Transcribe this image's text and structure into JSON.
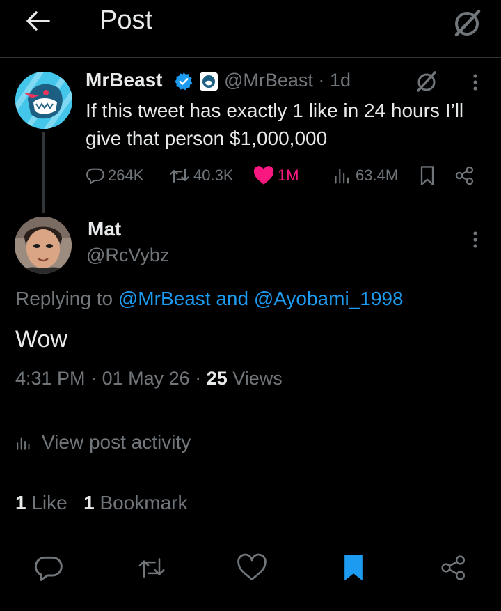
{
  "header": {
    "title": "Post"
  },
  "parent_tweet": {
    "author_name": "MrBeast",
    "handle_time": "@MrBeast · 1d",
    "text": "If this tweet has exactly 1 like in 24 hours I’ll give that person $1,000,000",
    "stats": {
      "replies": "264K",
      "reposts": "40.3K",
      "likes": "1M",
      "views": "63.4M"
    }
  },
  "reply": {
    "author_name": "Mat",
    "handle": "@RcVybz",
    "replying_prefix": "Replying to",
    "replying_users": "@MrBeast and @Ayobami_1998",
    "body": "Wow",
    "time": "4:31 PM",
    "date": "01 May 26",
    "views_count": "25",
    "views_label": "Views",
    "activity_label": "View post activity",
    "likes_count": "1",
    "likes_label": "Like",
    "bookmarks_count": "1",
    "bookmarks_label": "Bookmark"
  },
  "colors": {
    "background": "#000000",
    "text_primary": "#e7e9ea",
    "text_secondary": "#71767b",
    "link": "#1d9bf0",
    "like_pink": "#f91880",
    "divider": "#2f3336"
  },
  "icons": {
    "back": "back-arrow-icon",
    "grok": "grok-icon",
    "more": "more-vertical-icon",
    "reply": "reply-icon",
    "repost": "repost-icon",
    "like": "heart-icon",
    "views": "views-icon",
    "bookmark": "bookmark-icon",
    "share": "share-icon",
    "verified": "verified-icon"
  }
}
